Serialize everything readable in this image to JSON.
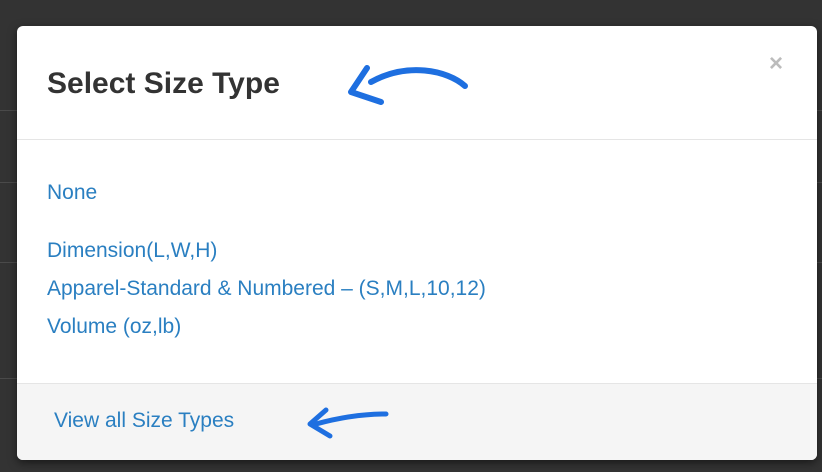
{
  "modal": {
    "title": "Select Size Type",
    "close_label": "×"
  },
  "options": [
    {
      "label": "None"
    },
    {
      "label": "Dimension(L,W,H)"
    },
    {
      "label": "Apparel-Standard & Numbered – (S,M,L,10,12)"
    },
    {
      "label": "Volume (oz,lb)"
    }
  ],
  "footer": {
    "view_all_label": "View all Size Types"
  },
  "colors": {
    "link": "#2a7fc1",
    "annotation_arrow": "#1e6fe0",
    "title": "#333333",
    "footer_bg": "#f5f5f5"
  },
  "icons": {
    "close": "close-icon",
    "annotation": "annotation-arrow-icon"
  }
}
